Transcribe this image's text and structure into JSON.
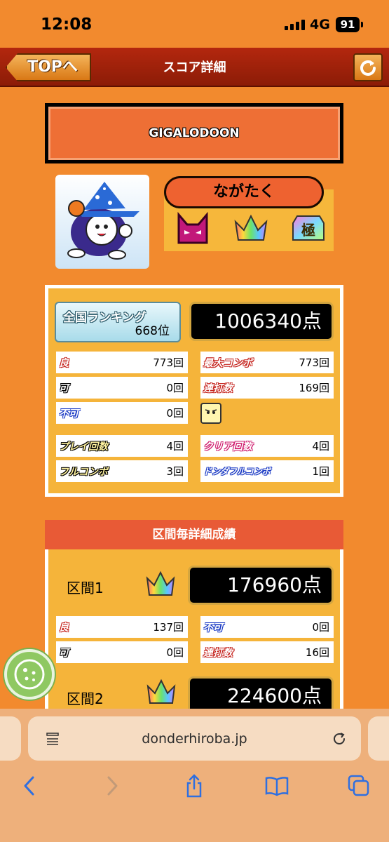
{
  "status_bar": {
    "time": "12:08",
    "network": "4G",
    "battery": "91"
  },
  "header": {
    "back_label": "TOPへ",
    "title": "スコア詳細"
  },
  "song": {
    "title": "GIGALODOON"
  },
  "player": {
    "name": "ながたく",
    "badges": [
      "cat-mask-icon",
      "rainbow-crown-icon",
      "extreme-difficulty-icon"
    ]
  },
  "ranking": {
    "label": "全国ランキング",
    "value": "668位"
  },
  "score": {
    "value": "1006340点"
  },
  "stats": {
    "good": {
      "label": "良",
      "value": "773回"
    },
    "ok": {
      "label": "可",
      "value": "0回"
    },
    "bad": {
      "label": "不可",
      "value": "0回"
    },
    "max_combo": {
      "label": "最大コンボ",
      "value": "773回"
    },
    "drumroll": {
      "label": "連打数",
      "value": "169回"
    },
    "play_count": {
      "label": "プレイ回数",
      "value": "4回"
    },
    "clear_count": {
      "label": "クリア回数",
      "value": "4回"
    },
    "full_combo": {
      "label": "フルコンボ",
      "value": "3回"
    },
    "donderful_combo": {
      "label": "ドンダフルコンボ",
      "value": "1回"
    }
  },
  "section_title": "区間毎詳細成績",
  "sections": [
    {
      "label": "区間1",
      "score": "176960点",
      "good": {
        "label": "良",
        "value": "137回"
      },
      "ok": {
        "label": "可",
        "value": "0回"
      },
      "bad": {
        "label": "不可",
        "value": "0回"
      },
      "drumroll": {
        "label": "連打数",
        "value": "16回"
      }
    },
    {
      "label": "区間2",
      "score": "224600点"
    }
  ],
  "browser": {
    "url": "donderhiroba.jp"
  }
}
